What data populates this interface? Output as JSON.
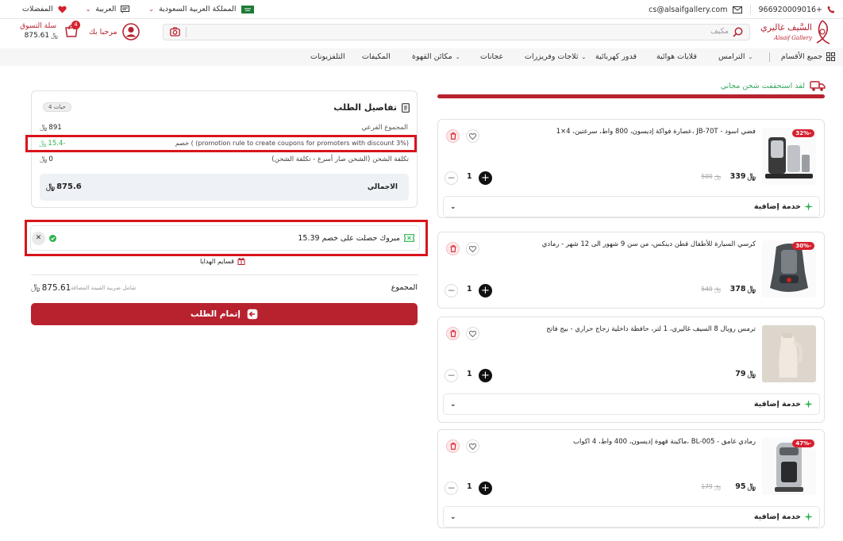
{
  "topbar": {
    "phone": "966920009016+",
    "email": "cs@alsaifgallery.com",
    "country": "المملكة العربية السعودية",
    "language": "العربية",
    "favorites": "المفضلات"
  },
  "header": {
    "logo_ar": "السَّيف غاليري",
    "logo_en": "Alsaif Gallery",
    "search_placeholder": "مكيف",
    "greeting": "مرحبا بك",
    "cart_label": "سلة التسوق",
    "cart_total": "875.61",
    "cart_count": "4"
  },
  "nav": {
    "all_categories": "جميع الأقسام",
    "items": [
      "الترامس",
      "قلايات هوائية",
      "قدور كهربائية",
      "ثلاجات وفريزرات",
      "عجانات",
      "مكائن القهوة",
      "المكيفات",
      "التلفزيونات"
    ]
  },
  "shipping": {
    "notice": "لقد استحققت شحن مجاني",
    "progress": 1.0
  },
  "products": [
    {
      "name": "عصارة فواكة إديسون، 800 واط، سرعتين، 4×1، JB-70T - فضي اسود",
      "price": "339",
      "old_price": "500",
      "discount": "32%-",
      "qty": "1",
      "image": "juicer",
      "service": "خدمة إضافية"
    },
    {
      "name": "كرسي السيارة للأطفال قطن دينكس، من سن 9 شهور الى 12 شهر - رمادي",
      "price": "378",
      "old_price": "540",
      "discount": "30%-",
      "qty": "1",
      "image": "car-seat",
      "service": "خدمة إضافية"
    },
    {
      "name": "ترمس رويال 8 السيف غاليري، 1 لتر، حافظة داخلية زجاج حراري - بيج فاتح",
      "price": "79",
      "old_price": "",
      "discount": "",
      "qty": "1",
      "image": "thermos",
      "service": "خدمة إضافية"
    },
    {
      "name": "ماكينة قهوة إديسون، 400 واط، 4 اكواب، BL-005 - رمادي غامق",
      "price": "95",
      "old_price": "179",
      "discount": "47%-",
      "qty": "1",
      "image": "coffee-machine",
      "service": "خدمة إضافية"
    }
  ],
  "order": {
    "title": "تفاصيل الطلب",
    "items_count": "4 حبات",
    "subtotal_label": "المجموع الفرعي",
    "subtotal": "891",
    "discount_label": "خصم ( (promotion rule to create coupons for promoters with discount 3%)",
    "discount": "15.4-",
    "shipping_label": "تكلفة الشحن (الشحن صار أسرع - تكلفة الشحن)",
    "shipping": "0",
    "total_label": "الاجمالي",
    "total": "875.6"
  },
  "coupon": {
    "message": "مبروك حصلت على خصم 15.39"
  },
  "gift": {
    "label": "قسايم الهدايا"
  },
  "summary": {
    "label": "المجموع",
    "vat_note": "شامل ضريبة القيمة المضافة",
    "total": "875.61"
  },
  "checkout": {
    "label": "إتمام الطلب"
  },
  "currency_symbol": "﷼",
  "colors": {
    "brand": "#b8222f",
    "green": "#2bb24c",
    "highlight": "#d9141b"
  }
}
